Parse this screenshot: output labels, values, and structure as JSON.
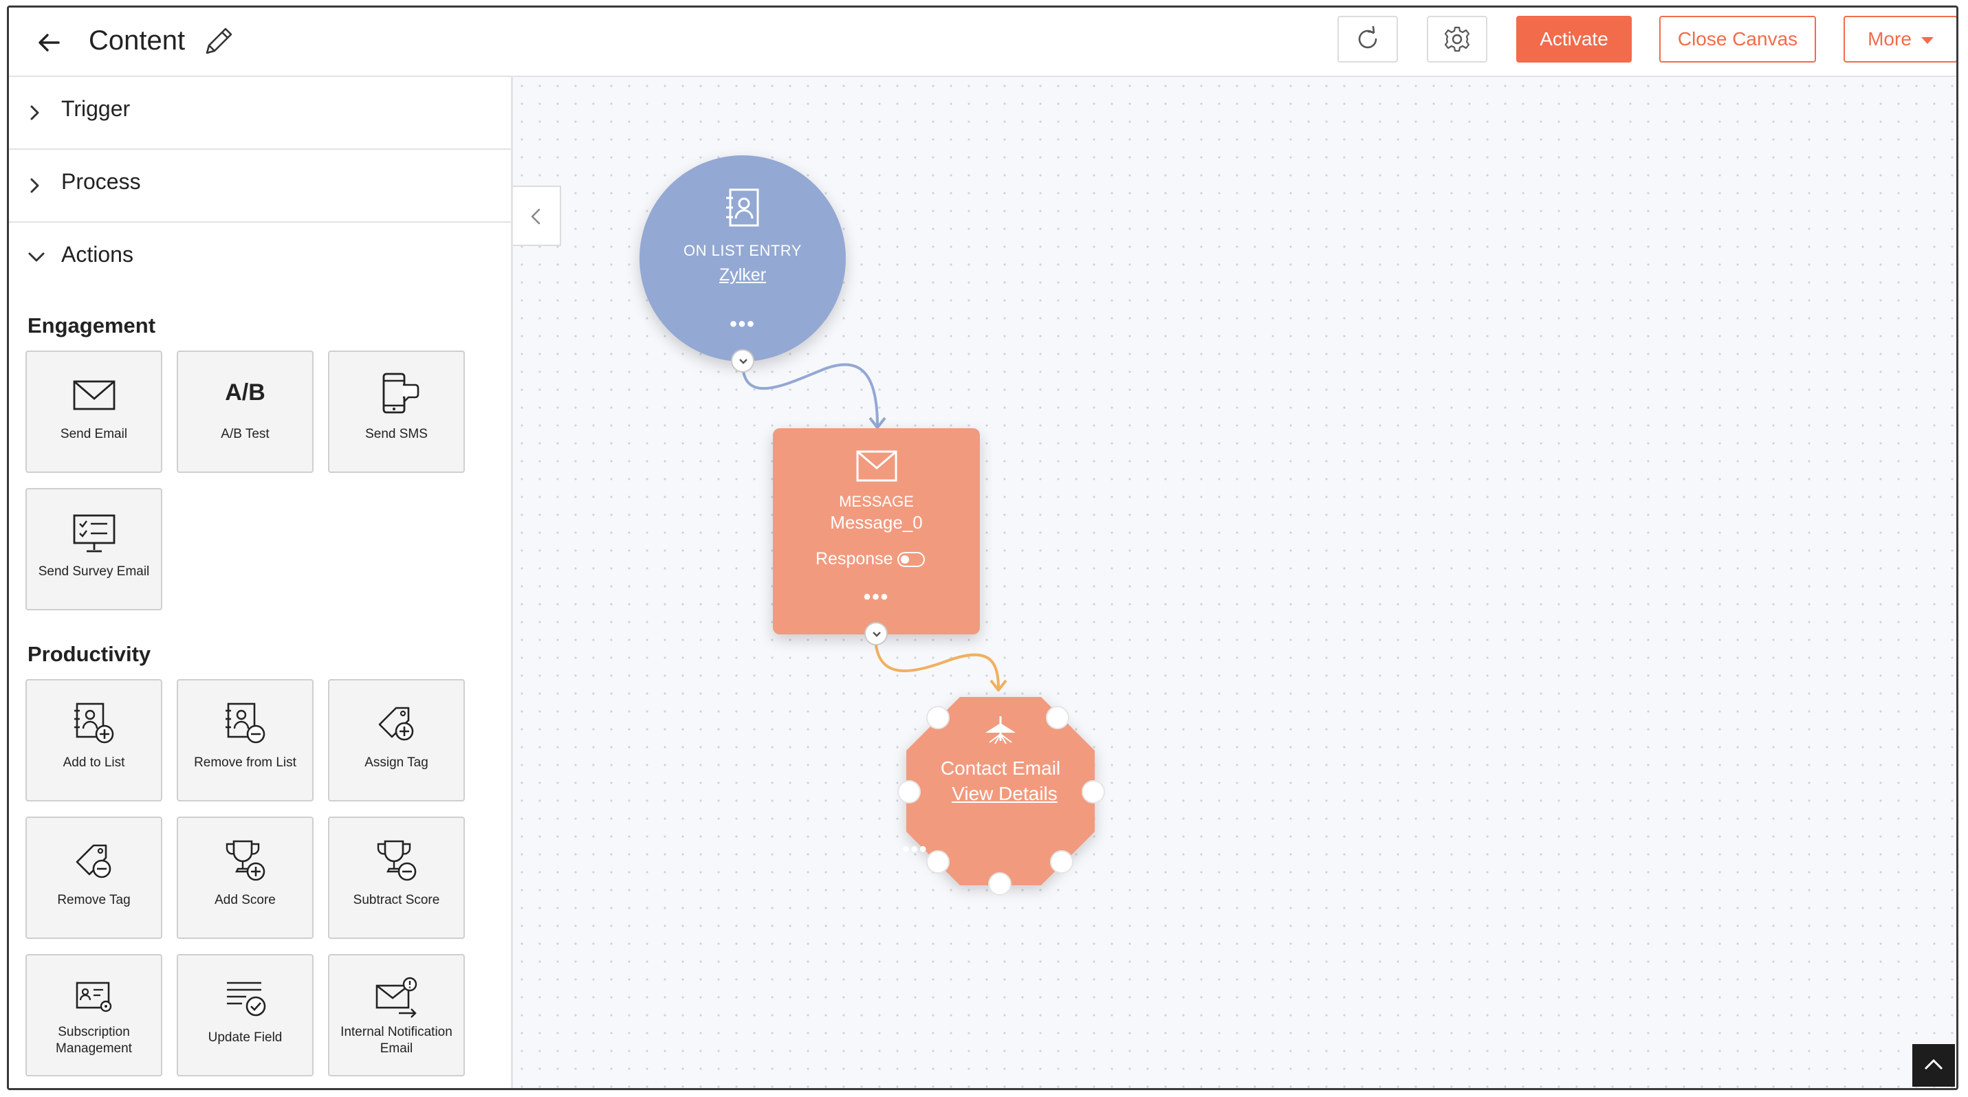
{
  "header": {
    "title": "Content",
    "activate_label": "Activate",
    "close_canvas_label": "Close Canvas",
    "more_label": "More",
    "accent_color": "#f26b4b"
  },
  "sidebar": {
    "sections": [
      {
        "label": "Trigger",
        "state": "collapsed"
      },
      {
        "label": "Process",
        "state": "collapsed"
      },
      {
        "label": "Actions",
        "state": "expanded"
      }
    ],
    "engagement": {
      "title": "Engagement",
      "items": [
        {
          "label": "Send Email",
          "icon": "envelope-icon"
        },
        {
          "label": "A/B Test",
          "icon": "ab-test-icon",
          "icon_text": "A/B"
        },
        {
          "label": "Send SMS",
          "icon": "phone-chat-icon"
        },
        {
          "label": "Send Survey Email",
          "icon": "survey-monitor-icon"
        }
      ]
    },
    "productivity": {
      "title": "Productivity",
      "items": [
        {
          "label": "Add to List",
          "icon": "list-add-icon"
        },
        {
          "label": "Remove from List",
          "icon": "list-remove-icon"
        },
        {
          "label": "Assign Tag",
          "icon": "tag-add-icon"
        },
        {
          "label": "Remove Tag",
          "icon": "tag-remove-icon"
        },
        {
          "label": "Add Score",
          "icon": "trophy-add-icon"
        },
        {
          "label": "Subtract Score",
          "icon": "trophy-remove-icon"
        },
        {
          "label": "Subscription Management",
          "icon": "subscription-card-icon"
        },
        {
          "label": "Update Field",
          "icon": "update-field-icon"
        },
        {
          "label": "Internal Notification Email",
          "icon": "notification-email-icon"
        }
      ]
    }
  },
  "canvas": {
    "entry_node": {
      "type": "ON LIST ENTRY",
      "name": "Zylker",
      "color": "#93a8d3"
    },
    "message_node": {
      "type": "MESSAGE",
      "name": "Message_0",
      "response_label": "Response",
      "color": "#f29a7e"
    },
    "goal_node": {
      "label": "Contact Email",
      "link": "View Details",
      "color": "#f29a7e"
    },
    "menu_dots": "•••"
  }
}
